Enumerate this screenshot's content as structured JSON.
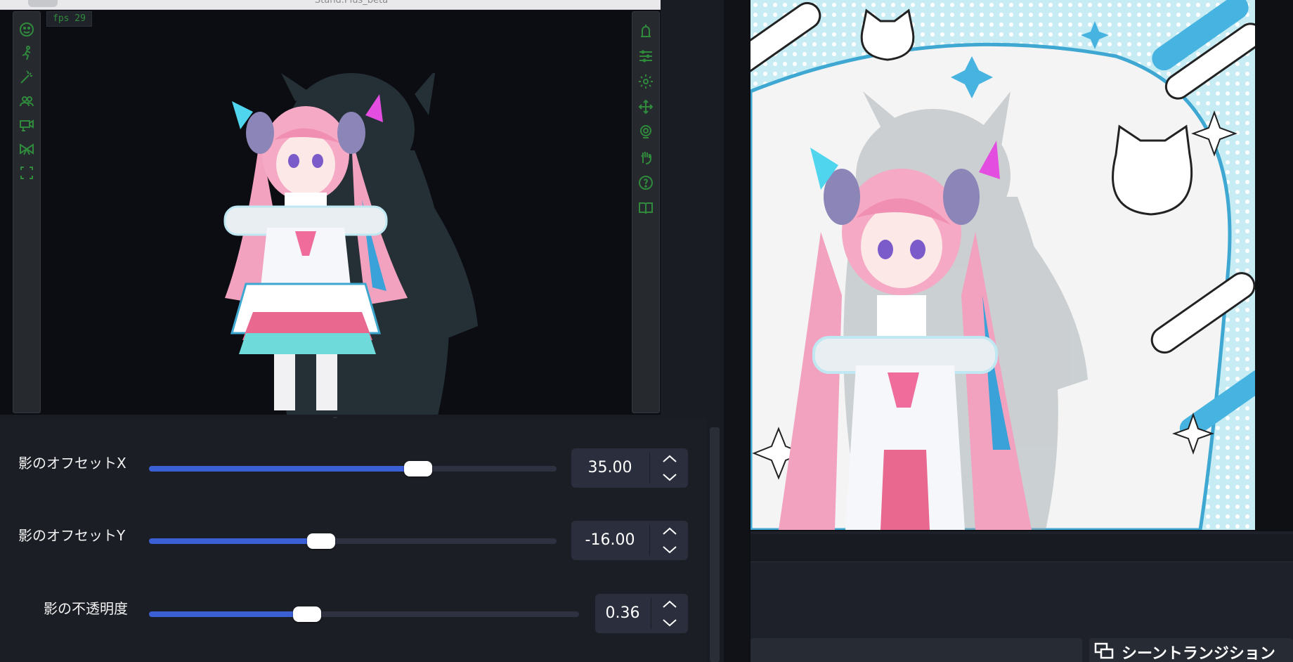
{
  "window": {
    "title": "Stand.Plus_beta"
  },
  "viewport": {
    "fps_label": "fps 29"
  },
  "left_toolbar": {
    "tools": [
      "face-icon",
      "body-pose-icon",
      "magic-wand-icon",
      "people-icon",
      "camera-icon",
      "ribbon-icon",
      "focus-frame-icon"
    ]
  },
  "right_toolbar": {
    "tools": [
      "light-icon",
      "sliders-icon",
      "settings-gear-icon",
      "move-arrows-icon",
      "webcam-icon",
      "hand-tracking-icon",
      "help-icon",
      "book-icon"
    ]
  },
  "settings": {
    "rows": [
      {
        "label": "影のオフセットX",
        "value": "35.00",
        "fraction": 0.66
      },
      {
        "label": "影のオフセットY",
        "value": "-16.00",
        "fraction": 0.42
      },
      {
        "label": "影の不透明度",
        "value": "0.36",
        "fraction": 0.36
      }
    ]
  },
  "obs": {
    "scene_transition_label": "シーントランジション"
  },
  "colors": {
    "accent": "#3b5fd4",
    "toolbar_icon": "#2f8a3c",
    "panel_bg": "#1b1e25",
    "preview_bg": "#e3f4f8",
    "hair_pink": "#f2a2bf"
  }
}
